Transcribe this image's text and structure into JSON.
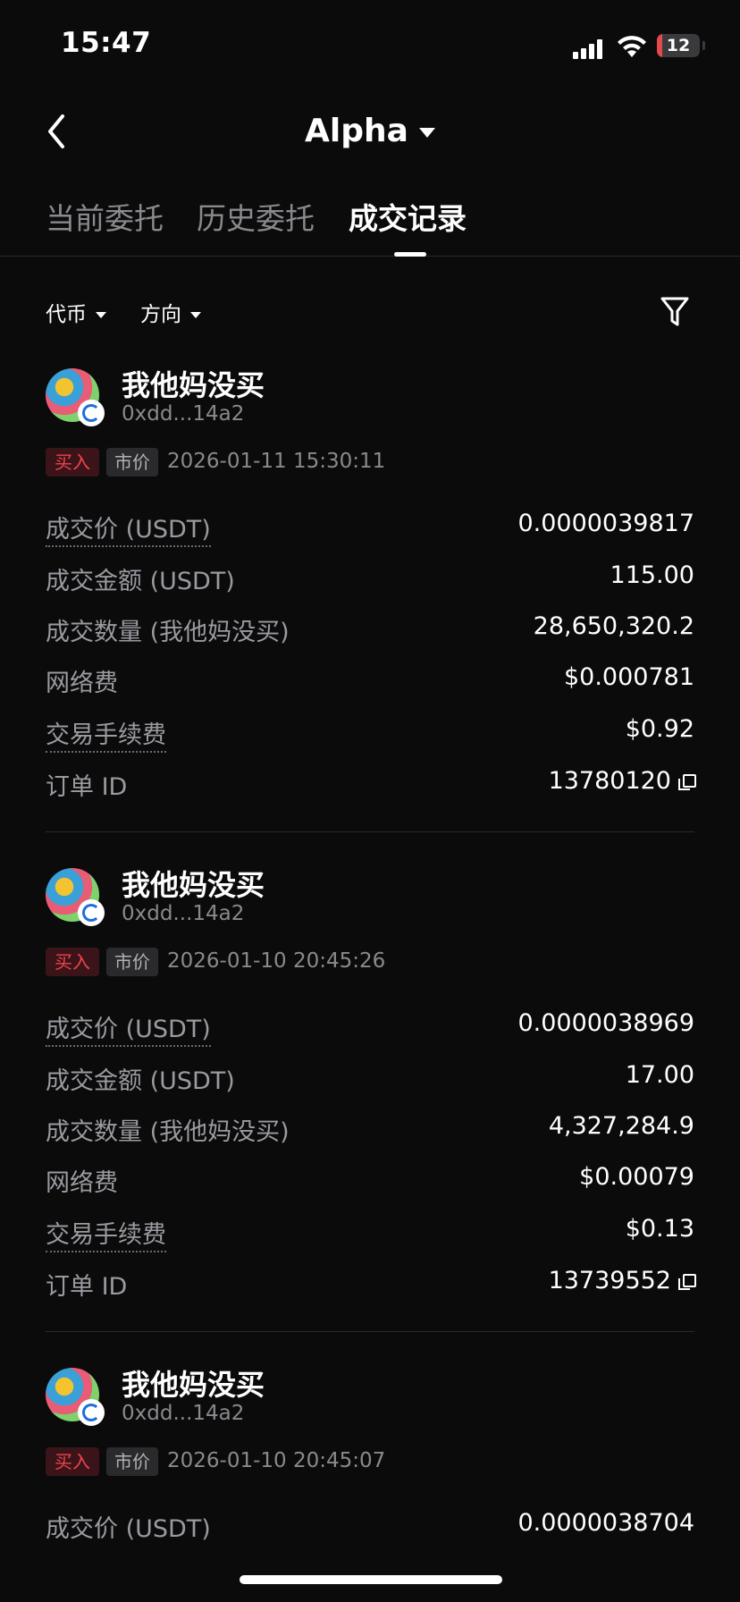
{
  "status_bar": {
    "time": "15:47",
    "battery": "12",
    "battery_level": 0.12
  },
  "nav": {
    "title": "Alpha"
  },
  "tabs": [
    {
      "label": "当前委托",
      "active": false
    },
    {
      "label": "历史委托",
      "active": false
    },
    {
      "label": "成交记录",
      "active": true
    }
  ],
  "filters": {
    "token": "代币",
    "direction": "方向"
  },
  "labels": {
    "price": "成交价 (USDT)",
    "amount": "成交金额 (USDT)",
    "quantity": "成交数量 (我他妈没买)",
    "network_fee": "网络费",
    "trade_fee": "交易手续费",
    "order_id": "订单 ID"
  },
  "trades": [
    {
      "token": "我他妈没买",
      "address": "0xdd...14a2",
      "side": "买入",
      "type": "市价",
      "time": "2026-01-11 15:30:11",
      "price": "0.0000039817",
      "amount": "115.00",
      "quantity": "28,650,320.2",
      "network_fee": "$0.000781",
      "trade_fee": "$0.92",
      "order_id": "13780120"
    },
    {
      "token": "我他妈没买",
      "address": "0xdd...14a2",
      "side": "买入",
      "type": "市价",
      "time": "2026-01-10 20:45:26",
      "price": "0.0000038969",
      "amount": "17.00",
      "quantity": "4,327,284.9",
      "network_fee": "$0.00079",
      "trade_fee": "$0.13",
      "order_id": "13739552"
    },
    {
      "token": "我他妈没买",
      "address": "0xdd...14a2",
      "side": "买入",
      "type": "市价",
      "time": "2026-01-10 20:45:07",
      "price": "0.0000038704"
    }
  ],
  "colors": {
    "background": "#0b0b0c",
    "buy_red": "#f0434e",
    "muted": "#8a8a8e"
  },
  "icons": {
    "back": "chevron-left-icon",
    "filter": "funnel-icon",
    "copy": "copy-icon"
  }
}
